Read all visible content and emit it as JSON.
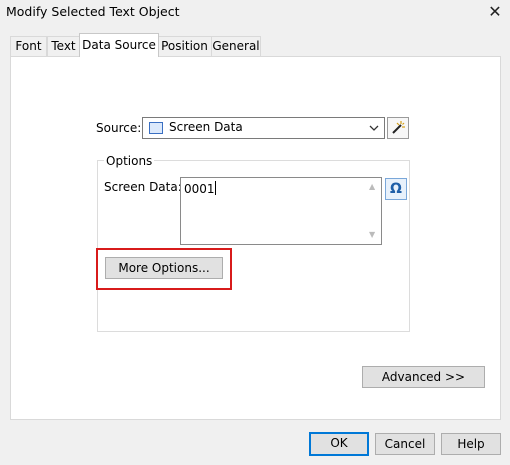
{
  "window": {
    "title": "Modify Selected Text Object"
  },
  "tabs": [
    {
      "label": "Font"
    },
    {
      "label": "Text"
    },
    {
      "label": "Data Source"
    },
    {
      "label": "Position"
    },
    {
      "label": "General"
    }
  ],
  "active_tab": "Data Source",
  "source": {
    "label": "Source:",
    "value": "Screen Data"
  },
  "options": {
    "legend": "Options",
    "screen_data_label": "Screen Data:",
    "screen_data_value": "0001",
    "more_options_label": "More Options..."
  },
  "buttons": {
    "advanced": "Advanced >>",
    "ok": "OK",
    "cancel": "Cancel",
    "help": "Help"
  },
  "colors": {
    "highlight": "#d81b1b",
    "accent": "#0078d7"
  },
  "icons": {
    "close": "close-icon",
    "source_type": "screen-data-icon",
    "wizard": "wand-icon",
    "symbol": "omega-icon"
  }
}
